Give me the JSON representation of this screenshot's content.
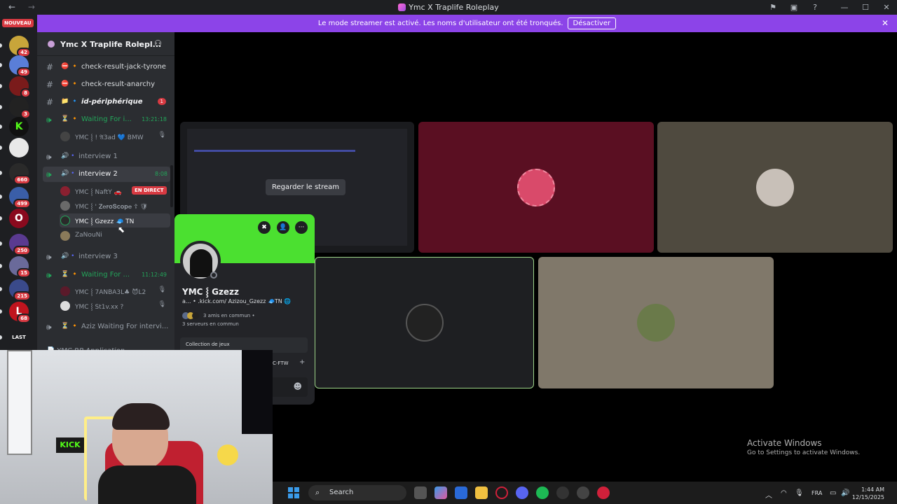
{
  "titlebar": {
    "back": "←",
    "forward": "→",
    "title": "Ymc X Traplife Roleplay",
    "inbox_icon": "⚑",
    "screen_icon": "▣",
    "help_icon": "?",
    "minimize": "—",
    "maximize": "☐",
    "close": "✕"
  },
  "banner": {
    "text": "Le mode streamer est activé. Les noms d'utilisateur ont été tronqués.",
    "button": "Désactiver",
    "close": "✕"
  },
  "rail": {
    "new_label": "NOUVEAU",
    "servers": [
      {
        "badge": "42",
        "color": "#c8a53a"
      },
      {
        "badge": "49",
        "color": "#5a7ed8"
      },
      {
        "badge": "8",
        "color": "#7a1b1b"
      },
      {
        "badge": "3",
        "color": "#222"
      },
      {
        "badge": "",
        "color": "#111",
        "text": "K"
      },
      {
        "badge": "",
        "color": "#e8e8e8"
      },
      {
        "badge": "660",
        "color": "#2a2a2a"
      },
      {
        "badge": "499",
        "color": "#3a5ea8"
      },
      {
        "badge": "",
        "color": "#8a0a1e",
        "text": "O"
      },
      {
        "badge": "250",
        "color": "#5a3a90"
      },
      {
        "badge": "15",
        "color": "#6a6a9a"
      },
      {
        "badge": "215",
        "color": "#3a4a8a"
      },
      {
        "badge": "68",
        "color": "#c0141e",
        "text": "L"
      },
      {
        "badge": "",
        "color": "#1e1f22",
        "text": "LAST"
      }
    ]
  },
  "sidebar": {
    "server_name": "Ymc X Traplife Rolepl...",
    "chevron": "⌄",
    "add_member": "👤+",
    "channels": [
      {
        "type": "text",
        "label": "check-result-jack-tyrone",
        "prefix": "⛔ 🔸"
      },
      {
        "type": "text",
        "label": "check-result-anarchy",
        "prefix": "⛔ 🔸"
      },
      {
        "type": "text",
        "label": "id-périphérique",
        "prefix": "📁 🔹",
        "count": "1"
      },
      {
        "type": "voice",
        "label": "Waiting For i...",
        "prefix": "⏳ 🔸",
        "time": "13:21:18"
      },
      {
        "type": "voice",
        "label": "interview 1",
        "prefix": "🔊 •"
      },
      {
        "type": "voice",
        "label": "interview 2",
        "prefix": "🔊 •",
        "time": "8:08"
      },
      {
        "type": "voice",
        "label": "interview 3",
        "prefix": "🔊 •"
      },
      {
        "type": "voice",
        "label": "Waiting For ...",
        "prefix": "⏳ 🔸",
        "time": "11:12:49"
      },
      {
        "type": "voice",
        "label": "Aziz Waiting For intervi...",
        "prefix": "⏳ 🔸"
      },
      {
        "type": "text",
        "label": "YMC RP Application",
        "prefix": "📄"
      }
    ],
    "users_wait1": [
      {
        "name": "YMC ⸾ ! 𝔄3ad 💙 BMW",
        "icon": "🎙"
      }
    ],
    "users_int2": [
      {
        "name": "YMC ⸾ NaftY 🚗",
        "live": "EN DIRECT"
      },
      {
        "name": "YMC ⸾ ' 𝐙𝐞𝐫𝐨𝐒𝐜𝐨𝐩𝐞 ☦ 🛡"
      },
      {
        "name": "YMC ⸾ Gzezz 🧢 TN"
      },
      {
        "name": "ZaNouNi"
      }
    ],
    "users_wait2": [
      {
        "name": "YMC ⸾ 7ANBA3L♣ 😈L2",
        "icon": "🎙"
      },
      {
        "name": "YMC ⸾ St1v.xx ?",
        "icon": "🎙"
      }
    ]
  },
  "stage": {
    "watch_label": "Regarder le stream"
  },
  "popup": {
    "name": "YMC ⸾ Gzezz",
    "subtitle": "a... • .kick.com/ Azizou_Gzezz 🧢TN 🌐",
    "friends": "3 amis en commun •",
    "servers": "3 serveurs en commun",
    "collection": "Collection de jeux",
    "game": "C-FTW",
    "plus": "+",
    "btn1": "✖",
    "btn2": "👤",
    "btn3": "···",
    "emoji": "☻"
  },
  "taskbar": {
    "search": "Search",
    "lang": "FRA",
    "time": "1:44 AM",
    "date": "12/15/2025",
    "tray_chevron": "︿",
    "wifi": "◠",
    "mic": "🎙",
    "vol": "🔊",
    "notif": "🔔"
  },
  "watermark": {
    "line1": "Activate Windows",
    "line2": "Go to Settings to activate Windows."
  }
}
